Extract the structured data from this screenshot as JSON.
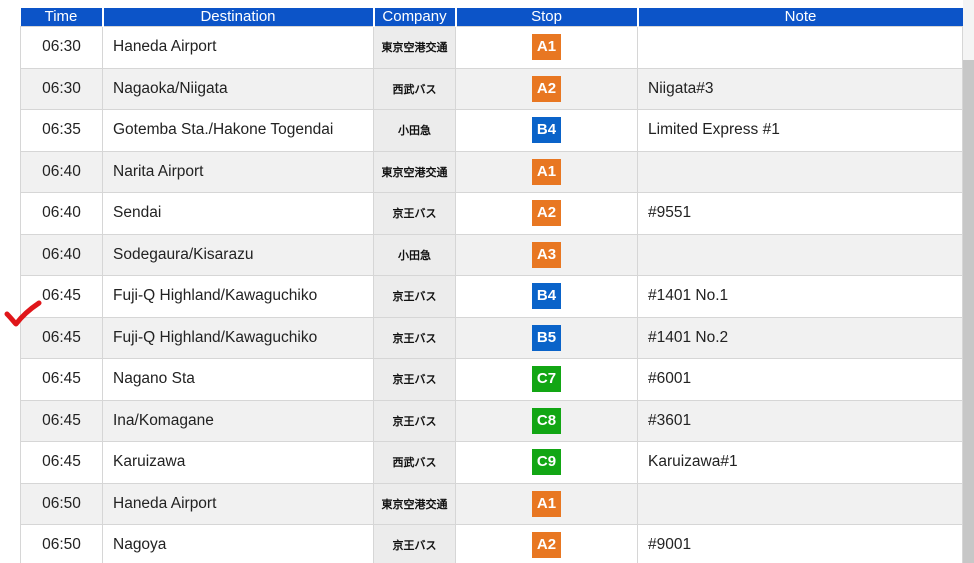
{
  "columns": {
    "time": "Time",
    "destination": "Destination",
    "company": "Company",
    "stop": "Stop",
    "note": "Note"
  },
  "stop_colors": {
    "A": "#e87722",
    "B": "#0a63c9",
    "C": "#12a614"
  },
  "rows": [
    {
      "time": "06:30",
      "destination": "Haneda Airport",
      "company": "東京空港交通",
      "stop": "A1",
      "note": ""
    },
    {
      "time": "06:30",
      "destination": "Nagaoka/Niigata",
      "company": "西武バス",
      "stop": "A2",
      "note": "Niigata#3"
    },
    {
      "time": "06:35",
      "destination": "Gotemba Sta./Hakone Togendai",
      "company": "小田急",
      "stop": "B4",
      "note": "Limited Express #1"
    },
    {
      "time": "06:40",
      "destination": "Narita Airport",
      "company": "東京空港交通",
      "stop": "A1",
      "note": ""
    },
    {
      "time": "06:40",
      "destination": "Sendai",
      "company": "京王バス",
      "stop": "A2",
      "note": "#9551"
    },
    {
      "time": "06:40",
      "destination": "Sodegaura/Kisarazu",
      "company": "小田急",
      "stop": "A3",
      "note": ""
    },
    {
      "time": "06:45",
      "destination": "Fuji-Q Highland/Kawaguchiko",
      "company": "京王バス",
      "stop": "B4",
      "note": "#1401 No.1"
    },
    {
      "time": "06:45",
      "destination": "Fuji-Q Highland/Kawaguchiko",
      "company": "京王バス",
      "stop": "B5",
      "note": "#1401 No.2"
    },
    {
      "time": "06:45",
      "destination": "Nagano Sta",
      "company": "京王バス",
      "stop": "C7",
      "note": "#6001"
    },
    {
      "time": "06:45",
      "destination": "Ina/Komagane",
      "company": "京王バス",
      "stop": "C8",
      "note": "#3601"
    },
    {
      "time": "06:45",
      "destination": "Karuizawa",
      "company": "西武バス",
      "stop": "C9",
      "note": "Karuizawa#1"
    },
    {
      "time": "06:50",
      "destination": "Haneda Airport",
      "company": "東京空港交通",
      "stop": "A1",
      "note": ""
    },
    {
      "time": "06:50",
      "destination": "Nagoya",
      "company": "京王バス",
      "stop": "A2",
      "note": "#9001"
    }
  ],
  "annotation": {
    "icon": "checkmark-icon",
    "color": "#e0161a"
  }
}
